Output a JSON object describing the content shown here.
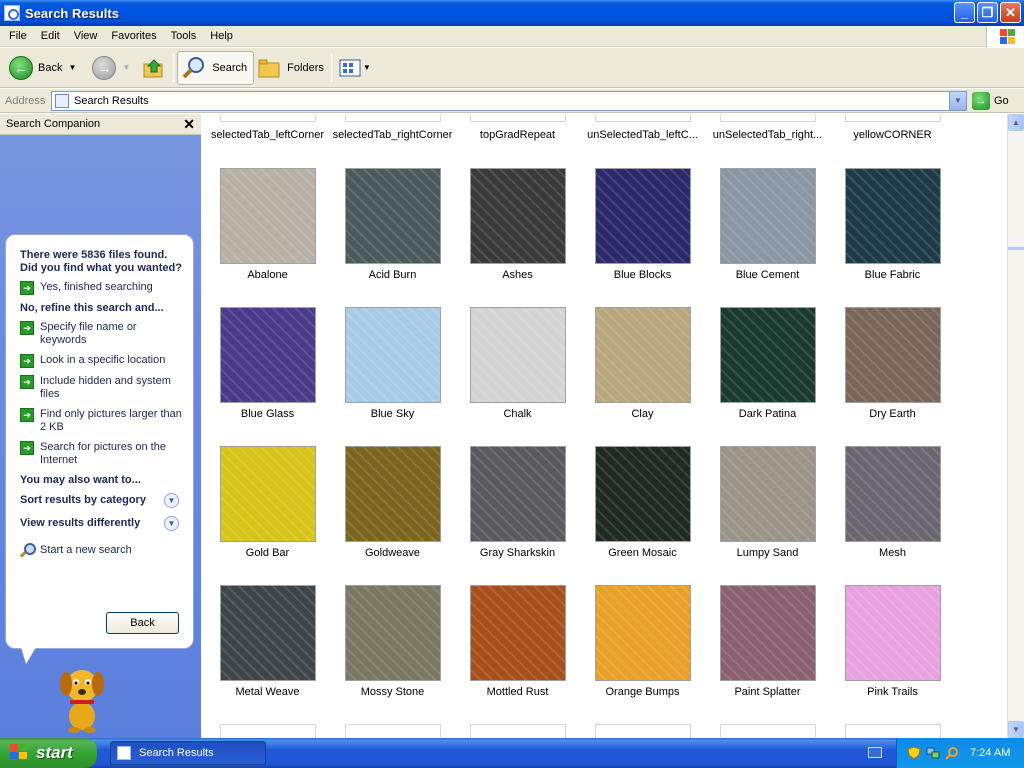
{
  "window": {
    "title": "Search Results"
  },
  "menu": [
    "File",
    "Edit",
    "View",
    "Favorites",
    "Tools",
    "Help"
  ],
  "toolbar": {
    "back_label": "Back",
    "search_label": "Search",
    "folders_label": "Folders"
  },
  "address": {
    "label": "Address",
    "value": "Search Results",
    "go_label": "Go"
  },
  "companion": {
    "title": "Search Companion",
    "message": "There were 5836 files found. Did you find what you wanted?",
    "yes_link": "Yes, finished searching",
    "refine_heading": "No, refine this search and...",
    "refine_links": [
      "Specify file name or keywords",
      "Look in a specific location",
      "Include hidden and system files",
      "Find only pictures larger than 2 KB",
      "Search for pictures on the Internet"
    ],
    "also_heading": "You may also want to...",
    "sort_label": "Sort results by category",
    "view_label": "View results differently",
    "new_search": "Start a new search",
    "back_button": "Back"
  },
  "results": {
    "previous_row": [
      "selectedTab_leftCorner",
      "selectedTab_rightCorner",
      "topGradRepeat",
      "unSelectedTab_leftC...",
      "unSelectedTab_right...",
      "yellowCORNER"
    ],
    "items": [
      {
        "name": "Abalone",
        "color": "#b8b0a4"
      },
      {
        "name": "Acid Burn",
        "color": "#4a5a5c"
      },
      {
        "name": "Ashes",
        "color": "#3a3a3a"
      },
      {
        "name": "Blue Blocks",
        "color": "#2a2a6a"
      },
      {
        "name": "Blue Cement",
        "color": "#8a96a4"
      },
      {
        "name": "Blue Fabric",
        "color": "#1e3a48"
      },
      {
        "name": "Blue Glass",
        "color": "#4a3a8a"
      },
      {
        "name": "Blue Sky",
        "color": "#a8cce8"
      },
      {
        "name": "Chalk",
        "color": "#d4d4d4"
      },
      {
        "name": "Clay",
        "color": "#b8a67c"
      },
      {
        "name": "Dark Patina",
        "color": "#1a3a30"
      },
      {
        "name": "Dry Earth",
        "color": "#7a6658"
      },
      {
        "name": "Gold Bar",
        "color": "#d8c418"
      },
      {
        "name": "Goldweave",
        "color": "#7a6420"
      },
      {
        "name": "Gray Sharkskin",
        "color": "#5a5a5e"
      },
      {
        "name": "Green Mosaic",
        "color": "#1e2a22"
      },
      {
        "name": "Lumpy Sand",
        "color": "#9a9488"
      },
      {
        "name": "Mesh",
        "color": "#6a6670"
      },
      {
        "name": "Metal Weave",
        "color": "#3e4448"
      },
      {
        "name": "Mossy Stone",
        "color": "#7a7860"
      },
      {
        "name": "Mottled Rust",
        "color": "#a8501a"
      },
      {
        "name": "Orange Bumps",
        "color": "#e8a02a"
      },
      {
        "name": "Paint Splatter",
        "color": "#8a6070"
      },
      {
        "name": "Pink Trails",
        "color": "#e8a0e0"
      }
    ]
  },
  "taskbar": {
    "start_label": "start",
    "task_label": "Search Results",
    "time": "7:24 AM"
  }
}
